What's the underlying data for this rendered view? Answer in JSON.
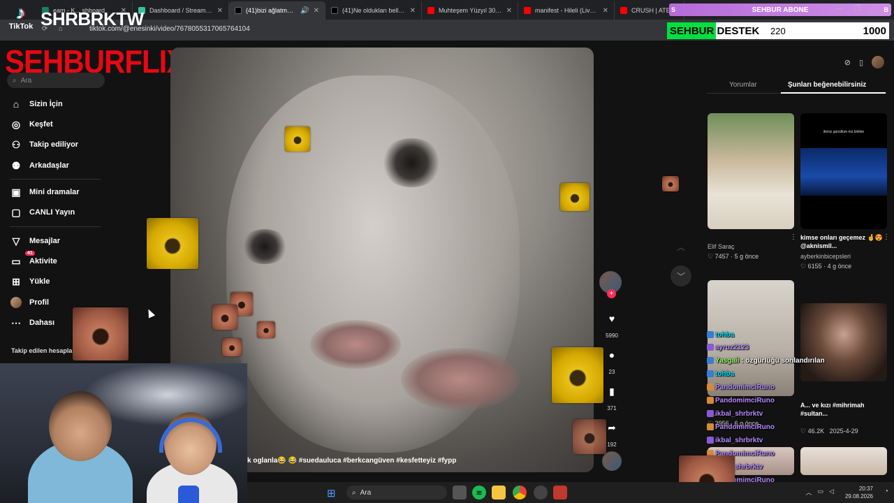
{
  "browser": {
    "tabs": [
      {
        "title": "eam - K... shboard",
        "favicon_color": "#1a7f5a",
        "active": false
      },
      {
        "title": "Dashboard / Streamlabs",
        "favicon_color": "#31c3a2",
        "active": false
      },
      {
        "title": "(41)bizi ağlatmaya ka...",
        "favicon_color": "#000000",
        "active": true
      },
      {
        "title": "(41)Ne oldukları belli old...",
        "favicon_color": "#000000",
        "active": false
      },
      {
        "title": "Muhteşem Yüzyıl 30. Bölü...",
        "favicon_color": "#ff0000",
        "active": false
      },
      {
        "title": "manifest - Hileli (Live Perf...",
        "favicon_color": "#ff0000",
        "active": false
      },
      {
        "title": "CRUSH | ATEEZ - MOS...",
        "favicon_color": "#ff0000",
        "active": false
      }
    ],
    "url": "tiktok.com/@enesinki/video/7678055317065764104",
    "window_controls": [
      "—",
      "❐",
      "✕"
    ]
  },
  "stream": {
    "tiktok_word": "TikTok",
    "channel_name": "SHRBRKTW",
    "abone_bar": {
      "left": "S",
      "label": "SEHBUR ABONE",
      "right": "B",
      "color": "#c47ddf"
    },
    "destek_bar": {
      "label": "SEHBUR DESTEK",
      "current": "220",
      "max": "1000",
      "progress": 0.22,
      "fill_color": "#00e040"
    }
  },
  "sidebar": {
    "brand": "SEHBURFLIX",
    "search_placeholder": "Ara",
    "items": [
      {
        "label": "Sizin İçin",
        "icon": "home-icon"
      },
      {
        "label": "Keşfet",
        "icon": "compass-icon"
      },
      {
        "label": "Takip ediliyor",
        "icon": "following-icon"
      },
      {
        "label": "Arkadaşlar",
        "icon": "friends-icon"
      },
      {
        "label": "Mini dramalar",
        "icon": "drama-icon"
      },
      {
        "label": "CANLI Yayın",
        "icon": "live-icon"
      },
      {
        "label": "Mesajlar",
        "icon": "send-icon"
      },
      {
        "label": "Aktivite",
        "icon": "activity-icon",
        "badge": "41"
      },
      {
        "label": "Yükle",
        "icon": "upload-icon"
      },
      {
        "label": "Profil",
        "icon": "profile-avatar"
      },
      {
        "label": "Dahası",
        "icon": "more-icon"
      }
    ],
    "following_title": "Takip edilen hesaplar"
  },
  "video": {
    "caption": "k oglanla😂 😂 #suedauluca #berkcangüven #kesfetteyiz #fypp",
    "actions": {
      "likes": "5990",
      "comments": "23",
      "saves": "371",
      "shares": "192"
    }
  },
  "right_panel": {
    "tabs": [
      "Yorumlar",
      "Şunları beğenebilirsiniz"
    ],
    "active_tab": 1,
    "cards": [
      {
        "title": "",
        "user": "Elif Saraç",
        "likes": "7457",
        "age": "5 g önce"
      },
      {
        "title": "kimse onları geçemez 🤞😍 @aknismll...",
        "user": "ayberkinbicepsleri",
        "likes": "6155",
        "age": "4 g önce"
      },
      {
        "title": "",
        "user": "as...",
        "likes": "3956",
        "age": "6 g önce"
      },
      {
        "title": "A... ve kızı #mihrimah #sultan...",
        "user": "",
        "likes": "46.2K",
        "age": "2025-4-29"
      }
    ],
    "thumb_text": "ikimiz günüllüm mü birlikte"
  },
  "chat": [
    {
      "name": "tohba",
      "message": "",
      "color": "#00e5ff"
    },
    {
      "name": "ayruz2123",
      "message": "",
      "color": "#b48cff"
    },
    {
      "name": "Yasgaii",
      "message": "özgürlüğü sonlandırılan",
      "color": "#9cff6a"
    },
    {
      "name": "tohba",
      "message": "",
      "color": "#00e5ff"
    },
    {
      "name": "PandomimciRuno",
      "message": "",
      "color": "#b48cff"
    },
    {
      "name": "PandomimciRuno",
      "message": "",
      "color": "#b48cff"
    },
    {
      "name": "ikbal_shrbrktv",
      "message": "",
      "color": "#b48cff"
    },
    {
      "name": "PandomimciRuno",
      "message": "",
      "color": "#b48cff"
    },
    {
      "name": "ikbal_shrbrktv",
      "message": "",
      "color": "#b48cff"
    },
    {
      "name": "PandomimciRuno",
      "message": "",
      "color": "#b48cff"
    },
    {
      "name": "ikbal_shrbrktv",
      "message": "",
      "color": "#b48cff"
    },
    {
      "name": "PandomimciRuno",
      "message": "",
      "color": "#b48cff"
    }
  ],
  "taskbar": {
    "search_label": "Ara",
    "apps": [
      "windows-start-icon",
      "task-view-icon",
      "spotify-icon",
      "explorer-icon",
      "chrome-icon",
      "steam-icon",
      "video-app-icon"
    ],
    "time": "20:37",
    "date": "29.08.2026"
  }
}
